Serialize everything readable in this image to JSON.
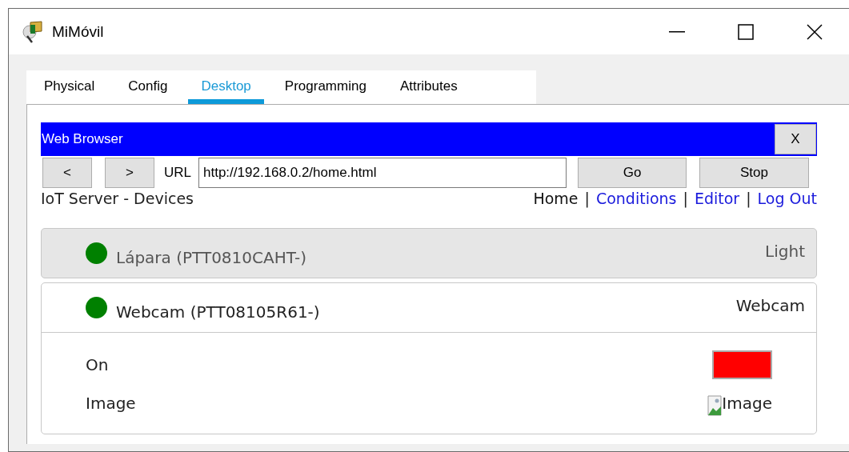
{
  "window": {
    "title": "MiMóvil"
  },
  "tabs": [
    {
      "label": "Physical",
      "selected": false
    },
    {
      "label": "Config",
      "selected": false
    },
    {
      "label": "Desktop",
      "selected": true
    },
    {
      "label": "Programming",
      "selected": false
    },
    {
      "label": "Attributes",
      "selected": false
    }
  ],
  "browser": {
    "title": "Web Browser",
    "close_label": "X",
    "back_label": "<",
    "forward_label": ">",
    "url_label": "URL",
    "url": "http://192.168.0.2/home.html",
    "go_label": "Go",
    "stop_label": "Stop"
  },
  "page": {
    "heading": "IoT Server - Devices",
    "links": [
      {
        "label": "Home",
        "kind": "plain"
      },
      {
        "label": "Conditions",
        "kind": "link"
      },
      {
        "label": "Editor",
        "kind": "link"
      },
      {
        "label": "Log Out",
        "kind": "link"
      }
    ],
    "separator": "|",
    "devices": [
      {
        "name": "Lápara (PTT0810CAHT-)",
        "type": "Light",
        "color": "#008000",
        "expanded": false
      },
      {
        "name": "Webcam (PTT08105R61-)",
        "type": "Webcam",
        "color": "#008000",
        "expanded": true,
        "fields": [
          {
            "label": "On",
            "kind": "toggle",
            "on": false
          },
          {
            "label": "Image",
            "kind": "image",
            "alt": "Image"
          }
        ]
      }
    ]
  }
}
